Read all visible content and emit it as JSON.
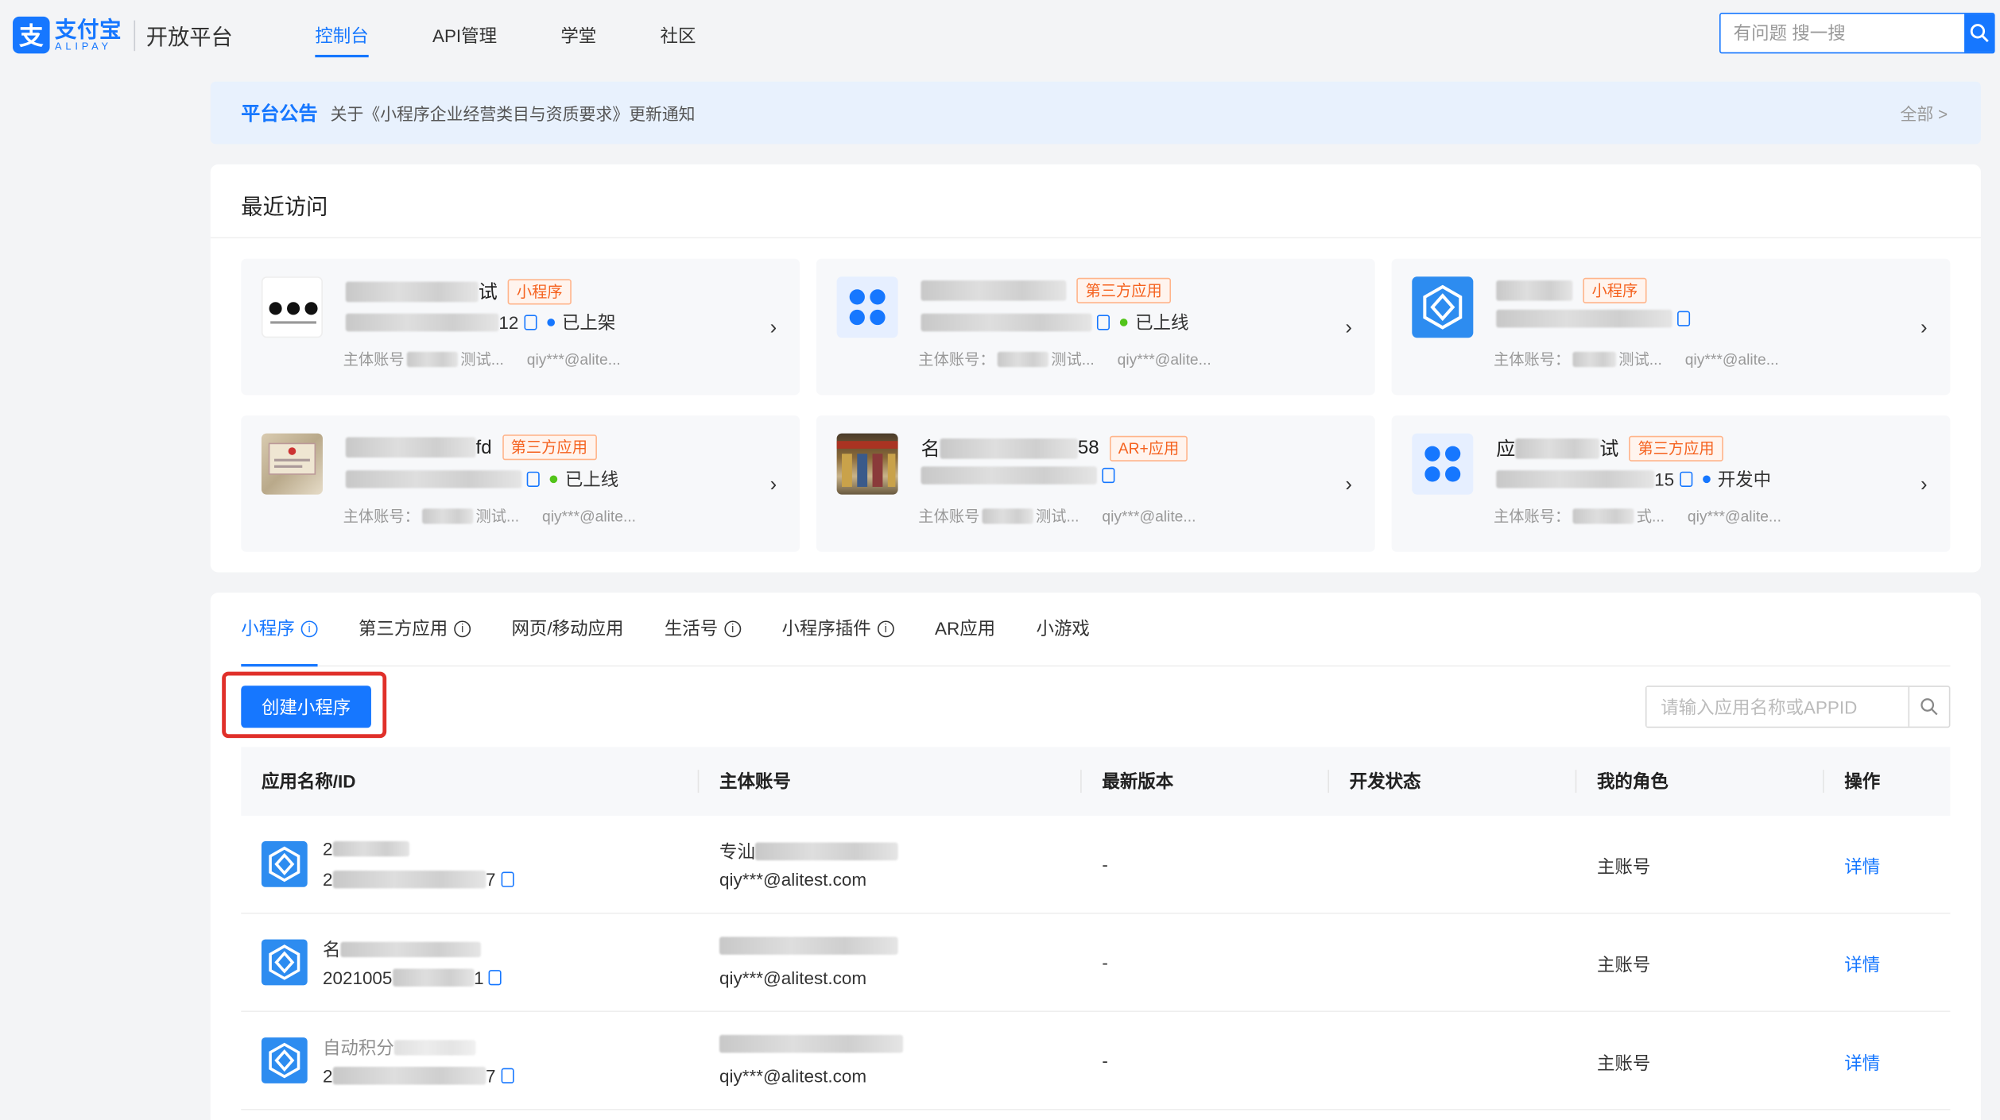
{
  "header": {
    "logo_cn": "支付宝",
    "logo_en": "ALIPAY",
    "logo_mark": "支",
    "platform": "开放平台",
    "nav": [
      {
        "label": "控制台",
        "active": true
      },
      {
        "label": "API管理",
        "active": false
      },
      {
        "label": "学堂",
        "active": false
      },
      {
        "label": "社区",
        "active": false
      }
    ],
    "search_placeholder": "有问题 搜一搜"
  },
  "notice": {
    "title": "平台公告",
    "text": "关于《小程序企业经营类目与资质要求》更新通知",
    "all": "全部 >"
  },
  "recent": {
    "title": "最近访问",
    "cards": [
      {
        "name_suffix": "试",
        "tag": "小程序",
        "id_suffix": "12",
        "status": "已上架",
        "status_color": "#1677ff",
        "owner_label": "主体账号",
        "owner_suffix": "测试...",
        "email": "qiy***@alite..."
      },
      {
        "name_suffix": "",
        "tag": "第三方应用",
        "id_suffix": "",
        "status": "已上线",
        "status_color": "#52c41a",
        "owner_label": "主体账号：",
        "owner_suffix": "测试...",
        "email": "qiy***@alite..."
      },
      {
        "name_suffix": "",
        "tag": "小程序",
        "id_suffix": "",
        "status": "",
        "status_color": "",
        "owner_label": "主体账号：",
        "owner_suffix": "测试...",
        "email": "qiy***@alite..."
      },
      {
        "name_suffix": "fd",
        "tag": "第三方应用",
        "id_suffix": "",
        "status": "已上线",
        "status_color": "#52c41a",
        "owner_label": "主体账号：",
        "owner_suffix": "测试...",
        "email": "qiy***@alite..."
      },
      {
        "name_prefix": "名",
        "name_suffix": "58",
        "tag": "AR+应用",
        "id_suffix": "",
        "status": "",
        "status_color": "",
        "owner_label": "主体账号",
        "owner_suffix": "测试...",
        "email": "qiy***@alite..."
      },
      {
        "name_prefix": "应",
        "name_suffix": "试",
        "tag": "第三方应用",
        "id_suffix": "15",
        "status": "开发中",
        "status_color": "#1677ff",
        "owner_label": "主体账号：",
        "owner_suffix": "式...",
        "email": "qiy***@alite..."
      }
    ]
  },
  "list": {
    "tabs": [
      {
        "label": "小程序",
        "info": true,
        "active": true
      },
      {
        "label": "第三方应用",
        "info": true,
        "active": false
      },
      {
        "label": "网页/移动应用",
        "info": false,
        "active": false
      },
      {
        "label": "生活号",
        "info": true,
        "active": false
      },
      {
        "label": "小程序插件",
        "info": true,
        "active": false
      },
      {
        "label": "AR应用",
        "info": false,
        "active": false
      },
      {
        "label": "小游戏",
        "info": false,
        "active": false
      }
    ],
    "create_button": "创建小程序",
    "search_placeholder": "请输入应用名称或APPID",
    "columns": [
      "应用名称/ID",
      "主体账号",
      "最新版本",
      "开发状态",
      "我的角色",
      "操作"
    ],
    "rows": [
      {
        "name_prefix": "2",
        "id_prefix": "2",
        "id_suffix": "7",
        "owner_prefix": "专汕",
        "email": "qiy***@alitest.com",
        "version": "-",
        "status": "",
        "role": "主账号",
        "action": "详情"
      },
      {
        "name_prefix": "名",
        "id_prefix": "2021005",
        "id_suffix": "1",
        "owner_prefix": "",
        "email": "qiy***@alitest.com",
        "version": "-",
        "status": "",
        "role": "主账号",
        "action": "详情"
      },
      {
        "name_prefix": "自动积分",
        "id_prefix": "2",
        "id_suffix": "7",
        "owner_prefix": "",
        "email": "qiy***@alitest.com",
        "version": "-",
        "status": "",
        "role": "主账号",
        "action": "详情"
      }
    ]
  },
  "colors": {
    "accent": "#1677ff",
    "tag_orange": "#f5621f",
    "highlight_red": "#e0302a"
  }
}
